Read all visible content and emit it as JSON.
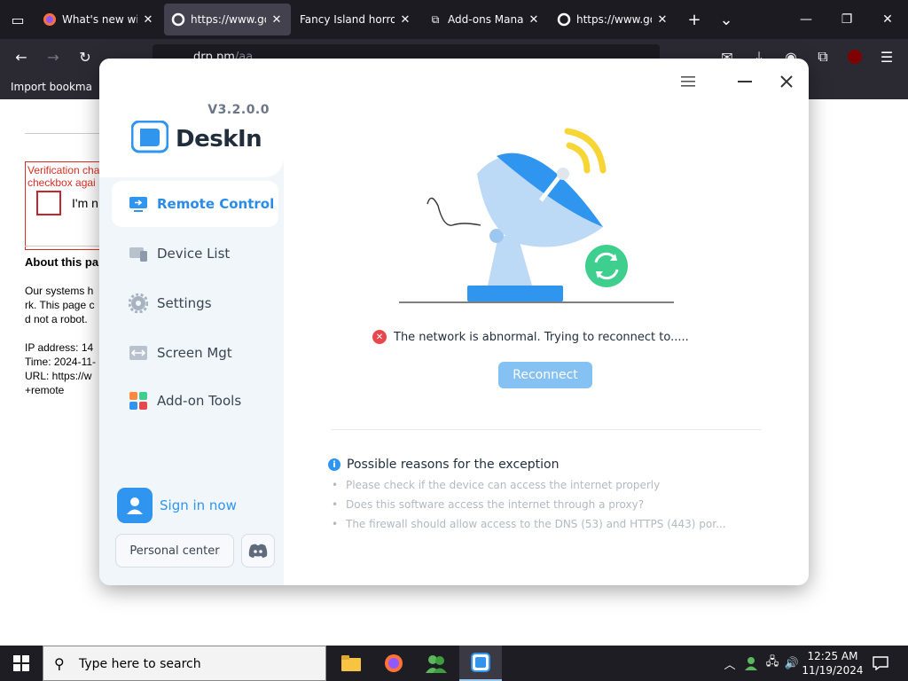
{
  "browser": {
    "tabs": [
      {
        "label": "What's new with",
        "active": false
      },
      {
        "label": "https://www.go",
        "active": true
      },
      {
        "label": "Fancy Island horror",
        "active": false
      },
      {
        "label": "Add-ons Manag",
        "active": false
      },
      {
        "label": "https://www.go",
        "active": false
      }
    ],
    "url_main": "drp.pm",
    "url_dim": "/aa",
    "bookmark_label": "Import bookma"
  },
  "page": {
    "verif_text": "Verification cha\ncheckbox agai",
    "captcha_label": "I'm n",
    "about_title": "About this pa",
    "para_text": "Our systems h\nrk. This page c\nd not a robot.\n\nIP address: 14\nTime: 2024-11-\nURL: https://w\n+remote"
  },
  "app": {
    "version": "V3.2.0.0",
    "brand": "DeskIn",
    "nav": [
      {
        "label": "Remote Control",
        "icon": "monitor-icon",
        "active": true
      },
      {
        "label": "Device List",
        "icon": "devices-icon",
        "active": false
      },
      {
        "label": "Settings",
        "icon": "gear-icon",
        "active": false
      },
      {
        "label": "Screen Mgt",
        "icon": "screen-arrows-icon",
        "active": false
      },
      {
        "label": "Add-on Tools",
        "icon": "grid-tools-icon",
        "active": false
      }
    ],
    "sign_in": "Sign in now",
    "personal_center": "Personal center",
    "error_message": "The network is abnormal. Trying to reconnect to.....",
    "reconnect": "Reconnect",
    "reasons_title": "Possible reasons for the exception",
    "reasons": [
      "Please check if the device can access the internet properly",
      "Does this software access the internet through a proxy?",
      "The firewall should allow access to the DNS (53) and HTTPS (443) por..."
    ],
    "colors": {
      "accent": "#2f95ee",
      "sidebar": "#f1f6fb",
      "error": "#e8474d",
      "success": "#3ecf8e"
    }
  },
  "taskbar": {
    "search_placeholder": "Type here to search",
    "time": "12:25 AM",
    "date": "11/19/2024"
  }
}
